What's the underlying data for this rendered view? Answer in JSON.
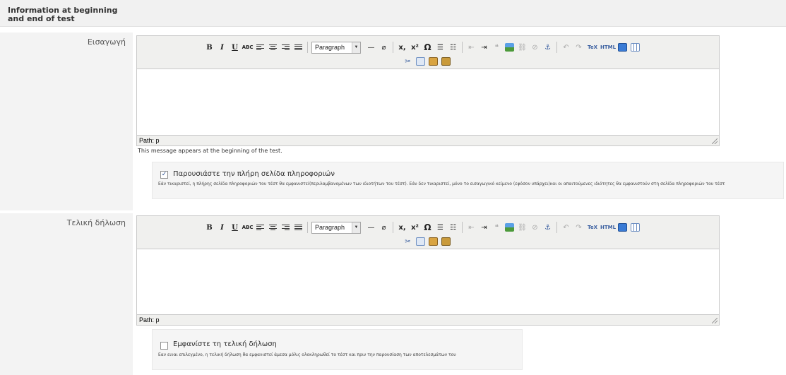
{
  "section": {
    "title": "Information at beginning and end of test"
  },
  "toolbar": {
    "buttons": {
      "bold": "B",
      "italic": "I",
      "underline": "U",
      "strikethrough": "ABC",
      "subscript": "x,",
      "superscript": "x²",
      "omega": "Ω",
      "tex": "TeX",
      "html": "HTML"
    },
    "format_value": "Paragraph"
  },
  "intro": {
    "label": "Εισαγωγή",
    "path": "Path: p",
    "hint": "This message appears at the beginning of the test."
  },
  "info_option": {
    "checked": true,
    "check_mark": "✓",
    "label": "Παρουσιάστε την πλήρη σελίδα πληροφοριών",
    "description": "Εάν τικαριστεί, η πλήρης σελίδα πληροφοριών του τέστ θα εμφανιστεί(περιλαμβανομένων των ιδιοτήτων του τέστ). Εάν δεν τικαριστεί, μόνο το εισαγωγικό κείμενο (εφόσον υπάρχει)και οι απαιτούμενες ιδιότητες θα εμφανιστούν στη σελίδα πληροφοριών του τέστ"
  },
  "final": {
    "label": "Τελική δήλωση",
    "path": "Path: p"
  },
  "final_option": {
    "checked": false,
    "check_mark": "",
    "label": "Εμφανίστε τη τελική δήλωση",
    "description": "Εαν ειναι επιλεγμένο, η τελική δήλωση θα εμφανιστεί άμεσα μόλις ολοκληρωθεί το τέστ και πριν την παρουσίαση των αποτελεσμάτων του"
  },
  "colors": {
    "header_bg": "#f1f1f1",
    "label_col_bg": "#f3f3f3",
    "editor_bg": "#f0f0ee",
    "check_blue": "#2a4f8f"
  }
}
